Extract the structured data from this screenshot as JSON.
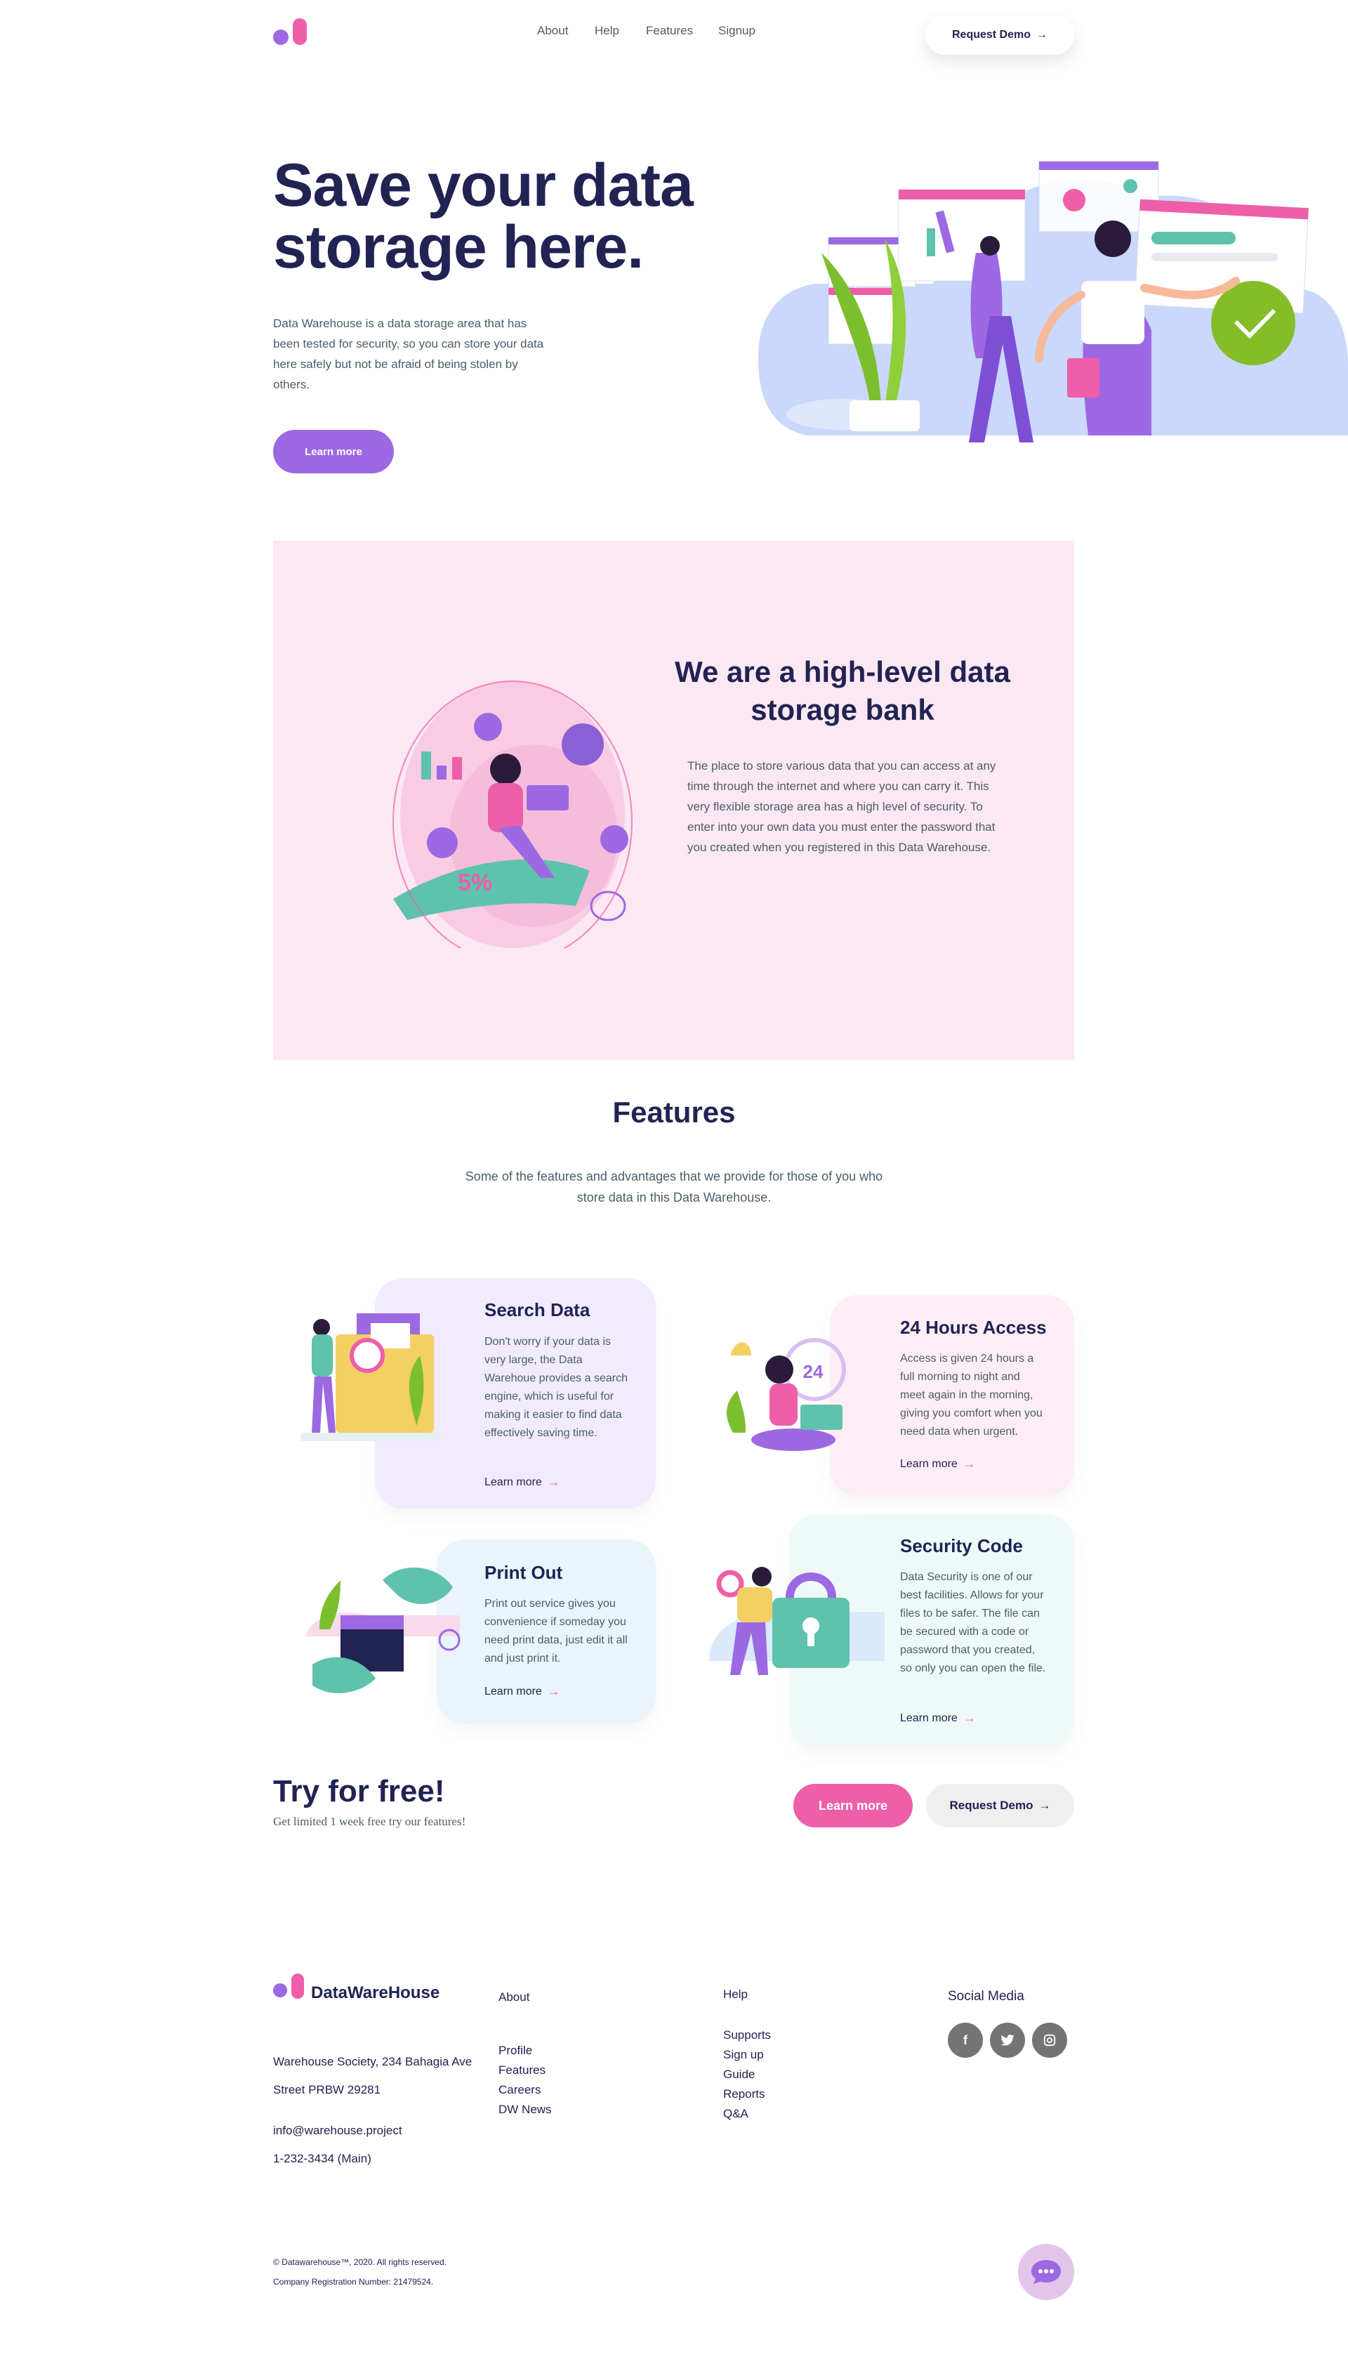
{
  "colors": {
    "navy": "#212353",
    "purple": "#9c69e2",
    "pink": "#ee5ea9",
    "pink_bg": "#fce8f3",
    "body_text": "#4b5d68"
  },
  "nav": {
    "links": [
      "About",
      "Help",
      "Features",
      "Signup"
    ],
    "demo_label": "Request Demo"
  },
  "hero": {
    "title": "Save your data storage here.",
    "text": "Data Warehouse is a data storage area that has been tested for security, so you can store your data here safely but not be afraid of being stolen by others.",
    "button": "Learn more"
  },
  "bank": {
    "title": "We are a high-level data storage bank",
    "text": "The place to store various data that you can access at any time through the internet and where you can carry it. This very flexible storage area has a high level of security. To enter into your own data you must enter the password that you created when you registered in this Data Warehouse."
  },
  "features": {
    "title": "Features",
    "subtitle": "Some of the features and advantages that we provide for those of you who store data in this Data Warehouse.",
    "cards": [
      {
        "title": "Search Data",
        "text": "Don't worry if your data is very large, the Data Warehoue provides a search engine, which is useful for making it easier to find data effectively saving time.",
        "link": "Learn more",
        "color": "#f1ebfd"
      },
      {
        "title": "24 Hours Access",
        "text": "Access is given 24 hours a full morning to night and meet again in the morning, giving you comfort when you need data when urgent.",
        "link": "Learn more",
        "color": "#fdeef6"
      },
      {
        "title": "Print Out",
        "text": "Print out service gives you convenience if someday you need print data, just edit it all and just print it.",
        "link": "Learn more",
        "color": "#e9f4fb"
      },
      {
        "title": "Security Code",
        "text": "Data Security is one of our best facilities. Allows for your files to be safer. The file can be secured with a code or password that you created, so only you can open the file.",
        "link": "Learn more",
        "color": "#effaf8"
      }
    ],
    "illustration_labels": {
      "access_hours": "24"
    }
  },
  "try": {
    "title": "Try for free!",
    "subtitle": "Get limited 1 week free try our features!",
    "learn": "Learn more",
    "demo": "Request Demo"
  },
  "footer": {
    "brand": "DataWareHouse",
    "address_1": "Warehouse Society, 234 Bahagia Ave",
    "address_2": "Street PRBW 29281",
    "email": "info@warehouse.project",
    "phone": "1-232-3434 (Main)",
    "about_title": "About",
    "about_links": [
      "Profile",
      "Features",
      "Careers",
      "DW News"
    ],
    "help_title": "Help",
    "help_links": [
      "Supports",
      "Sign up",
      "Guide",
      "Reports",
      "Q&A"
    ],
    "social_title": "Social Media",
    "social_icons": [
      "facebook-icon",
      "twitter-icon",
      "instagram-icon"
    ],
    "copyright": "© Datawarehouse™, 2020. All rights reserved.",
    "registration": "Company Registration Number: 21479524."
  }
}
